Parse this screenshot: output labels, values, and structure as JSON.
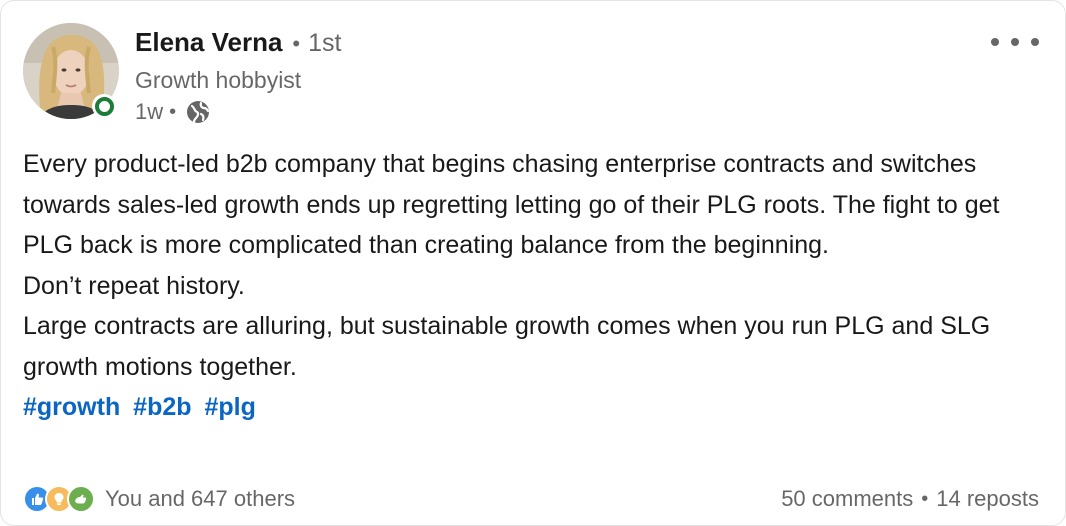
{
  "post": {
    "author": {
      "name": "Elena Verna",
      "connection_degree": "1st",
      "headline": "Growth hobbyist",
      "online_status_color": "#1c7d39"
    },
    "meta": {
      "age": "1w",
      "visibility_icon": "globe-icon"
    },
    "menu_icon": "more-horizontal-icon",
    "paragraphs": [
      "Every product-led b2b company that begins chasing enterprise contracts and switches towards sales-led growth ends up regretting letting go of their PLG roots. The fight to get PLG back is more complicated than creating balance from the beginning.",
      "Don’t repeat history.",
      "Large contracts are alluring, but sustainable growth comes when you run PLG and SLG growth motions together."
    ],
    "hashtags": [
      "#growth",
      "#b2b",
      "#plg"
    ],
    "hashtag_color": "#0a66c2",
    "social": {
      "reaction_icons": [
        "like-icon",
        "insightful-icon",
        "support-icon"
      ],
      "reactions_text": "You and 647 others",
      "comments": "50 comments",
      "reposts": "14 reposts"
    }
  }
}
